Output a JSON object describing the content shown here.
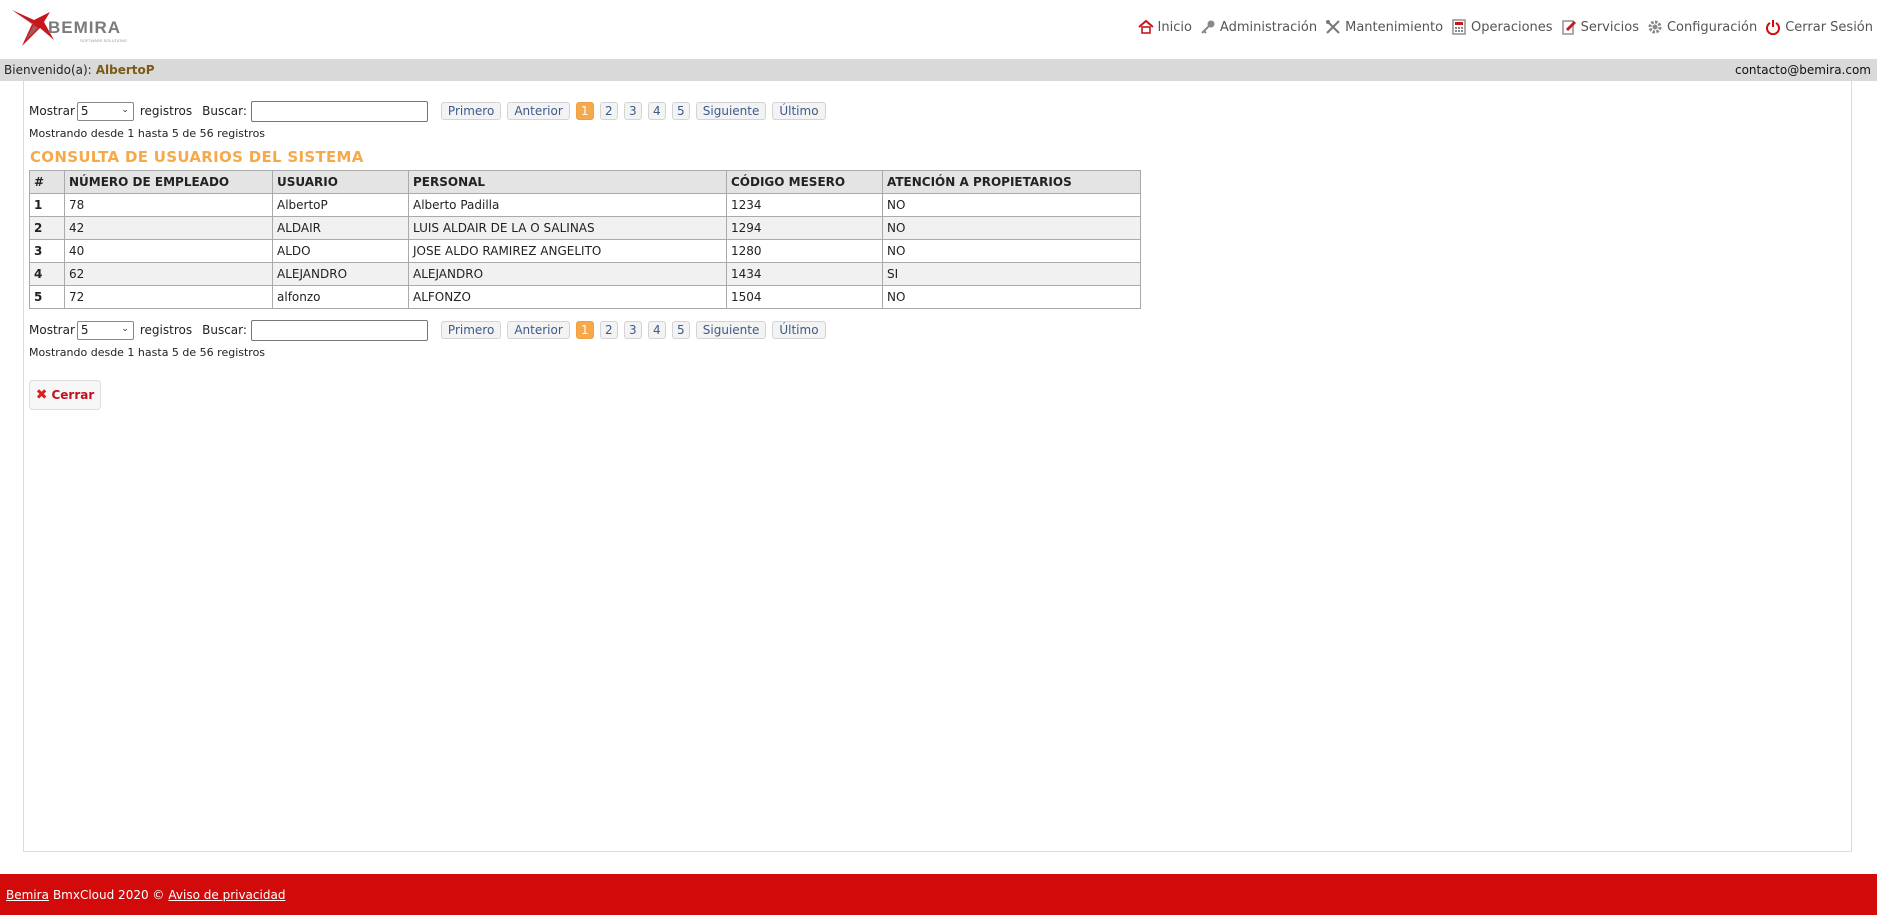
{
  "brand": {
    "logo_text": "BEMIRA",
    "logo_tagline": "SOFTWARE SOLUTIONS",
    "accent": "#f5a94a",
    "brand_red": "#d20a0a"
  },
  "nav": [
    {
      "label": "Inicio",
      "icon": "home-icon"
    },
    {
      "label": "Administración",
      "icon": "key-icon"
    },
    {
      "label": "Mantenimiento",
      "icon": "tools-icon"
    },
    {
      "label": "Operaciones",
      "icon": "calculator-icon"
    },
    {
      "label": "Servicios",
      "icon": "notepad-icon"
    },
    {
      "label": "Configuración",
      "icon": "gear-icon"
    },
    {
      "label": "Cerrar Sesión",
      "icon": "power-icon"
    }
  ],
  "welcome": {
    "prefix": "Bienvenido(a):",
    "user": "AlbertoP",
    "email": "contacto@bemira.com"
  },
  "controls": {
    "show_label": "Mostrar",
    "show_value": "5",
    "records_label": "registros",
    "search_label": "Buscar:",
    "search_value": "",
    "pager": {
      "first": "Primero",
      "prev": "Anterior",
      "pages": [
        "1",
        "2",
        "3",
        "4",
        "5"
      ],
      "active_page": "1",
      "next": "Siguiente",
      "last": "Último"
    },
    "info": "Mostrando desde 1 hasta 5 de 56 registros"
  },
  "table": {
    "title": "CONSULTA DE USUARIOS DEL SISTEMA",
    "columns": [
      "#",
      "NÚMERO DE EMPLEADO",
      "USUARIO",
      "PERSONAL",
      "CÓDIGO MESERO",
      "ATENCIÓN A PROPIETARIOS"
    ],
    "rows": [
      [
        "1",
        "78",
        "AlbertoP",
        "Alberto Padilla",
        "1234",
        "NO"
      ],
      [
        "2",
        "42",
        "ALDAIR",
        "LUIS ALDAIR DE LA O SALINAS",
        "1294",
        "NO"
      ],
      [
        "3",
        "40",
        "ALDO",
        "JOSE ALDO RAMIREZ ANGELITO",
        "1280",
        "NO"
      ],
      [
        "4",
        "62",
        "ALEJANDRO",
        "ALEJANDRO",
        "1434",
        "SI"
      ],
      [
        "5",
        "72",
        "alfonzo",
        "ALFONZO",
        "1504",
        "NO"
      ]
    ]
  },
  "close_button": {
    "label": "Cerrar",
    "icon": "close-icon"
  },
  "footer": {
    "brand_link": "Bemira",
    "text": "BmxCloud 2020 ©",
    "privacy_link": "Aviso de privacidad"
  }
}
